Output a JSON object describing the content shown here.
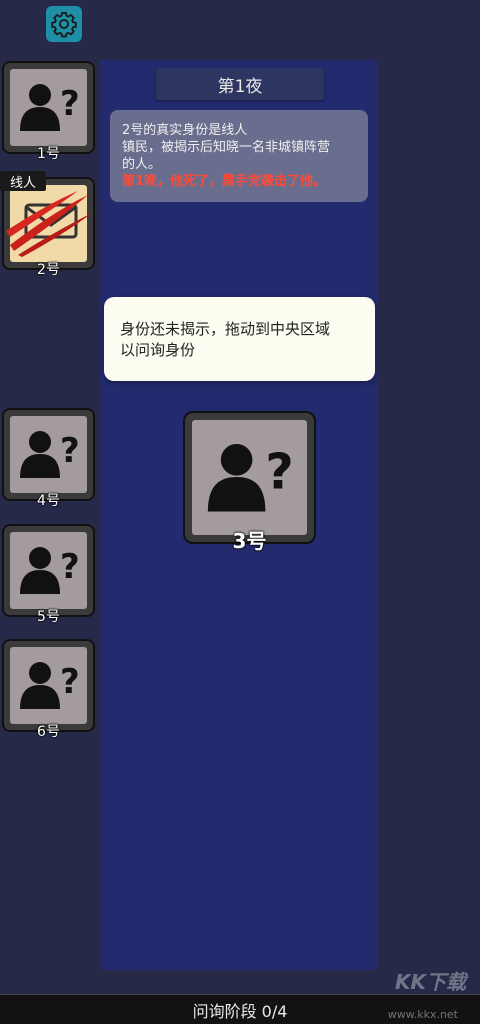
{
  "settings_icon": "gear-icon",
  "night_title": "第1夜",
  "log": {
    "line1": "2号的真实身份是线人",
    "line2": "镇民，被揭示后知晓一名非城镇阵营",
    "line3": "的人。",
    "death_line": "第1晚，他死了，黑手党袭击了他。"
  },
  "hint": {
    "line1": "身份还未揭示，拖动到中央区域",
    "line2": "以问询身份"
  },
  "players": [
    {
      "label": "1号",
      "icon": "unknown-person-icon"
    },
    {
      "label": "2号",
      "role_tag": "线人",
      "icon": "envelope-icon",
      "status": "attacked",
      "overlay_icon": "claw-slash-icon"
    },
    {
      "label": "4号",
      "icon": "unknown-person-icon"
    },
    {
      "label": "5号",
      "icon": "unknown-person-icon"
    },
    {
      "label": "6号",
      "icon": "unknown-person-icon"
    }
  ],
  "center_card": {
    "label": "3号",
    "icon": "unknown-person-icon"
  },
  "phase": "问询阶段 0/4",
  "watermark": "KK下载",
  "watermark_url": "www.kkx.net",
  "colors": {
    "accent": "#1f8fa6",
    "panel": "#232a6e",
    "death_text": "#ff4a3a"
  }
}
